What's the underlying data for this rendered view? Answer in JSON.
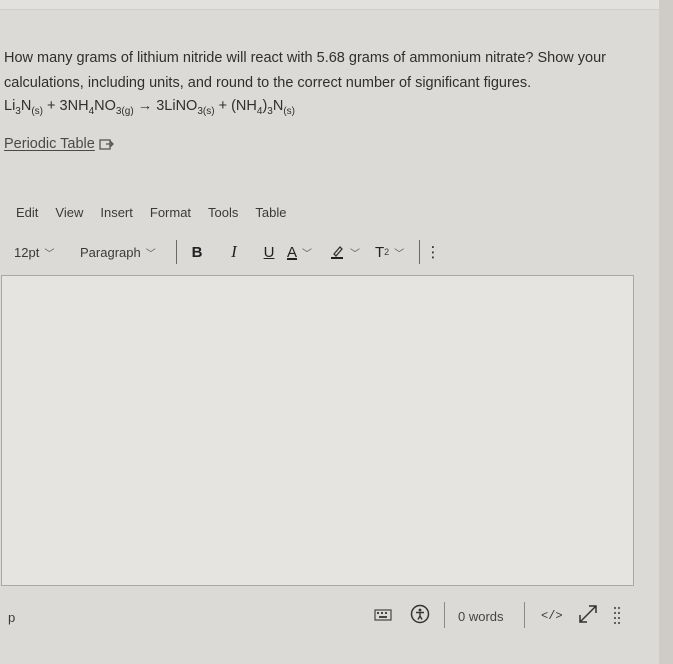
{
  "question": {
    "text": "How many grams of lithium nitride will react with 5.68 grams of ammonium nitrate? Show your calculations, including units, and round to the correct number of significant figures."
  },
  "equation": {
    "r1": "Li",
    "r1s1": "3",
    "r1b": "N",
    "r1s2": "(s)",
    "plus1": " + 3NH",
    "r2s1": "4",
    "r2b": "NO",
    "r2s2": "3(g)",
    "arrow": " → 3LiNO",
    "p1s": "3(s)",
    "plus2": " + (NH",
    "p2s1": "4",
    "p2b": ")",
    "p2s2": "3",
    "p2c": "N",
    "p2s3": "(s)"
  },
  "periodic_table": {
    "label": "Periodic Table"
  },
  "menu": {
    "edit": "Edit",
    "view": "View",
    "insert": "Insert",
    "format": "Format",
    "tools": "Tools",
    "table": "Table"
  },
  "toolbar": {
    "font_size": "12pt",
    "block_format": "Paragraph",
    "bold": "B",
    "italic": "I",
    "underline": "U",
    "text_color": "A",
    "superscript_base": "T",
    "superscript_exp": "2",
    "more": "⋮"
  },
  "editor": {
    "content": ""
  },
  "statusbar": {
    "path": "p",
    "word_count": "0 words",
    "html_toggle": "</>"
  },
  "icons": {
    "external": "external-link-icon",
    "keyboard": "keyboard-icon",
    "accessibility": "accessibility-icon",
    "fullscreen": "fullscreen-icon",
    "resize": "resize-handle-icon"
  },
  "colors": {
    "background": "#dcdad6",
    "editor_background": "#e6e4e0",
    "text": "#2f2f2f",
    "border": "#aaa8a4"
  }
}
